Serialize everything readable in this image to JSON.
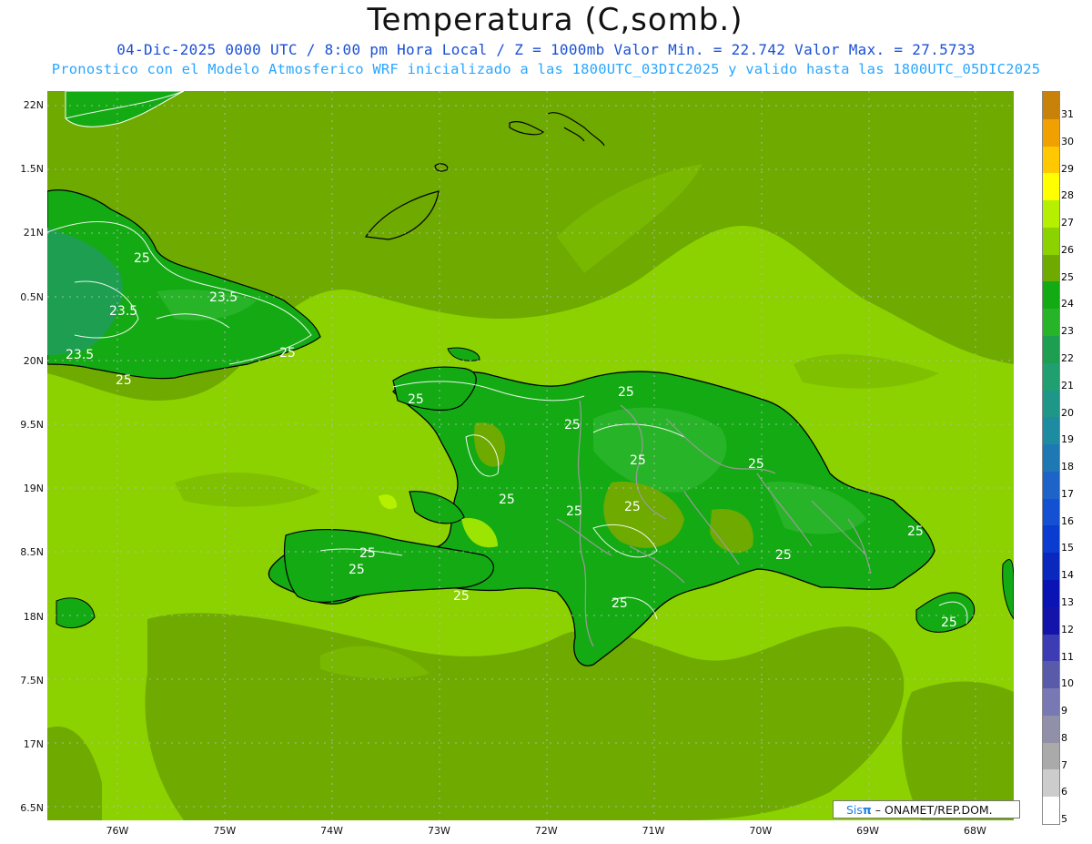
{
  "title": "Temperatura (C,somb.)",
  "subtitle_line1": "04-Dic-2025  0000 UTC / 8:00 pm Hora Local / Z = 1000mb   Valor Min. = 22.742  Valor Max. = 27.5733",
  "subtitle_line2": "Pronostico con el Modelo Atmosferico WRF inicializado a las 1800UTC_03DIC2025 y valido hasta las  1800UTC_05DIC2025",
  "watermark": {
    "brand": "Sis",
    "pi": "π",
    "rest": "– ONAMET/REP.DOM."
  },
  "lat_labels": [
    "22N",
    "21.5N",
    "21N",
    "20.5N",
    "20N",
    "19.5N",
    "19N",
    "18.5N",
    "18N",
    "17.5N",
    "17N",
    "16.5N"
  ],
  "lat_display": [
    "22N",
    "1.5N",
    "21N",
    "0.5N",
    "20N",
    "9.5N",
    "19N",
    "8.5N",
    "18N",
    "7.5N",
    "17N",
    "6.5N"
  ],
  "lon_labels": [
    "76W",
    "75W",
    "74W",
    "73W",
    "72W",
    "71W",
    "70W",
    "69W",
    "68W"
  ],
  "contour_labels": [
    "25",
    "23.5",
    "23.5",
    "23.5",
    "25",
    "25",
    "25",
    "25",
    "25",
    "25",
    "25",
    "25",
    "25",
    "25",
    "25",
    "25",
    "25",
    "25",
    "25",
    "25",
    "25"
  ],
  "legend": {
    "levels": [
      "31",
      "30",
      "29",
      "28",
      "27",
      "26",
      "25",
      "24",
      "23",
      "22",
      "21",
      "20",
      "19",
      "18",
      "17",
      "16",
      "15",
      "14",
      "13",
      "12",
      "11",
      "10",
      "9",
      "8",
      "7",
      "6",
      "5"
    ],
    "colors": [
      "#c8820a",
      "#f0a000",
      "#ffc800",
      "#ffff00",
      "#b4f000",
      "#8cd200",
      "#6eaa00",
      "#14aa14",
      "#28b428",
      "#1e9e50",
      "#20a070",
      "#1e9688",
      "#1e8ca0",
      "#1e78b4",
      "#1e64c8",
      "#1450d2",
      "#0a3cd2",
      "#0a28be",
      "#0a14b4",
      "#1414aa",
      "#3c3cb4",
      "#5a5aaa",
      "#7878b4",
      "#9090a8",
      "#aaaaaa",
      "#cccccc",
      "#ffffff"
    ]
  },
  "colors": {
    "ocean_warm": "#8cd200",
    "ocean_mid": "#6eaa00",
    "land": "#14aa14",
    "hot_spot": "#b4f000"
  }
}
